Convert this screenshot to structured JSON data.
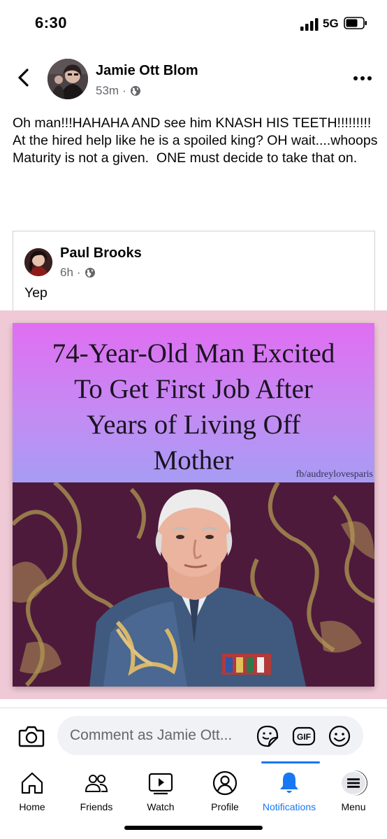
{
  "status": {
    "time": "6:30",
    "network": "5G"
  },
  "post": {
    "author": "Jamie Ott Blom",
    "time": "53m",
    "text": "Oh man!!!HAHAHA AND see him KNASH HIS TEETH!!!!!!!!!\nAt the hired help like he is a spoiled king? OH wait....whoops\nMaturity is not a given.  ONE must decide to take that on."
  },
  "shared": {
    "author": "Paul Brooks",
    "time": "6h",
    "text": "Yep",
    "meme_title_lines": [
      "74-Year-Old Man Excited",
      "To Get First Job After",
      "Years of Living Off",
      "Mother"
    ],
    "credit": "fb/audreylovesparis"
  },
  "comment_bar": {
    "placeholder": "Comment as Jamie Ott..."
  },
  "nav": {
    "items": [
      {
        "label": "Home",
        "icon": "home-icon"
      },
      {
        "label": "Friends",
        "icon": "friends-icon"
      },
      {
        "label": "Watch",
        "icon": "watch-icon"
      },
      {
        "label": "Profile",
        "icon": "profile-icon"
      },
      {
        "label": "Notifications",
        "icon": "bell-icon",
        "active": true
      },
      {
        "label": "Menu",
        "icon": "menu-avatar"
      }
    ]
  },
  "colors": {
    "accent": "#1877f2",
    "secondary_text": "#65676b",
    "meme_band": "#efcad6"
  }
}
